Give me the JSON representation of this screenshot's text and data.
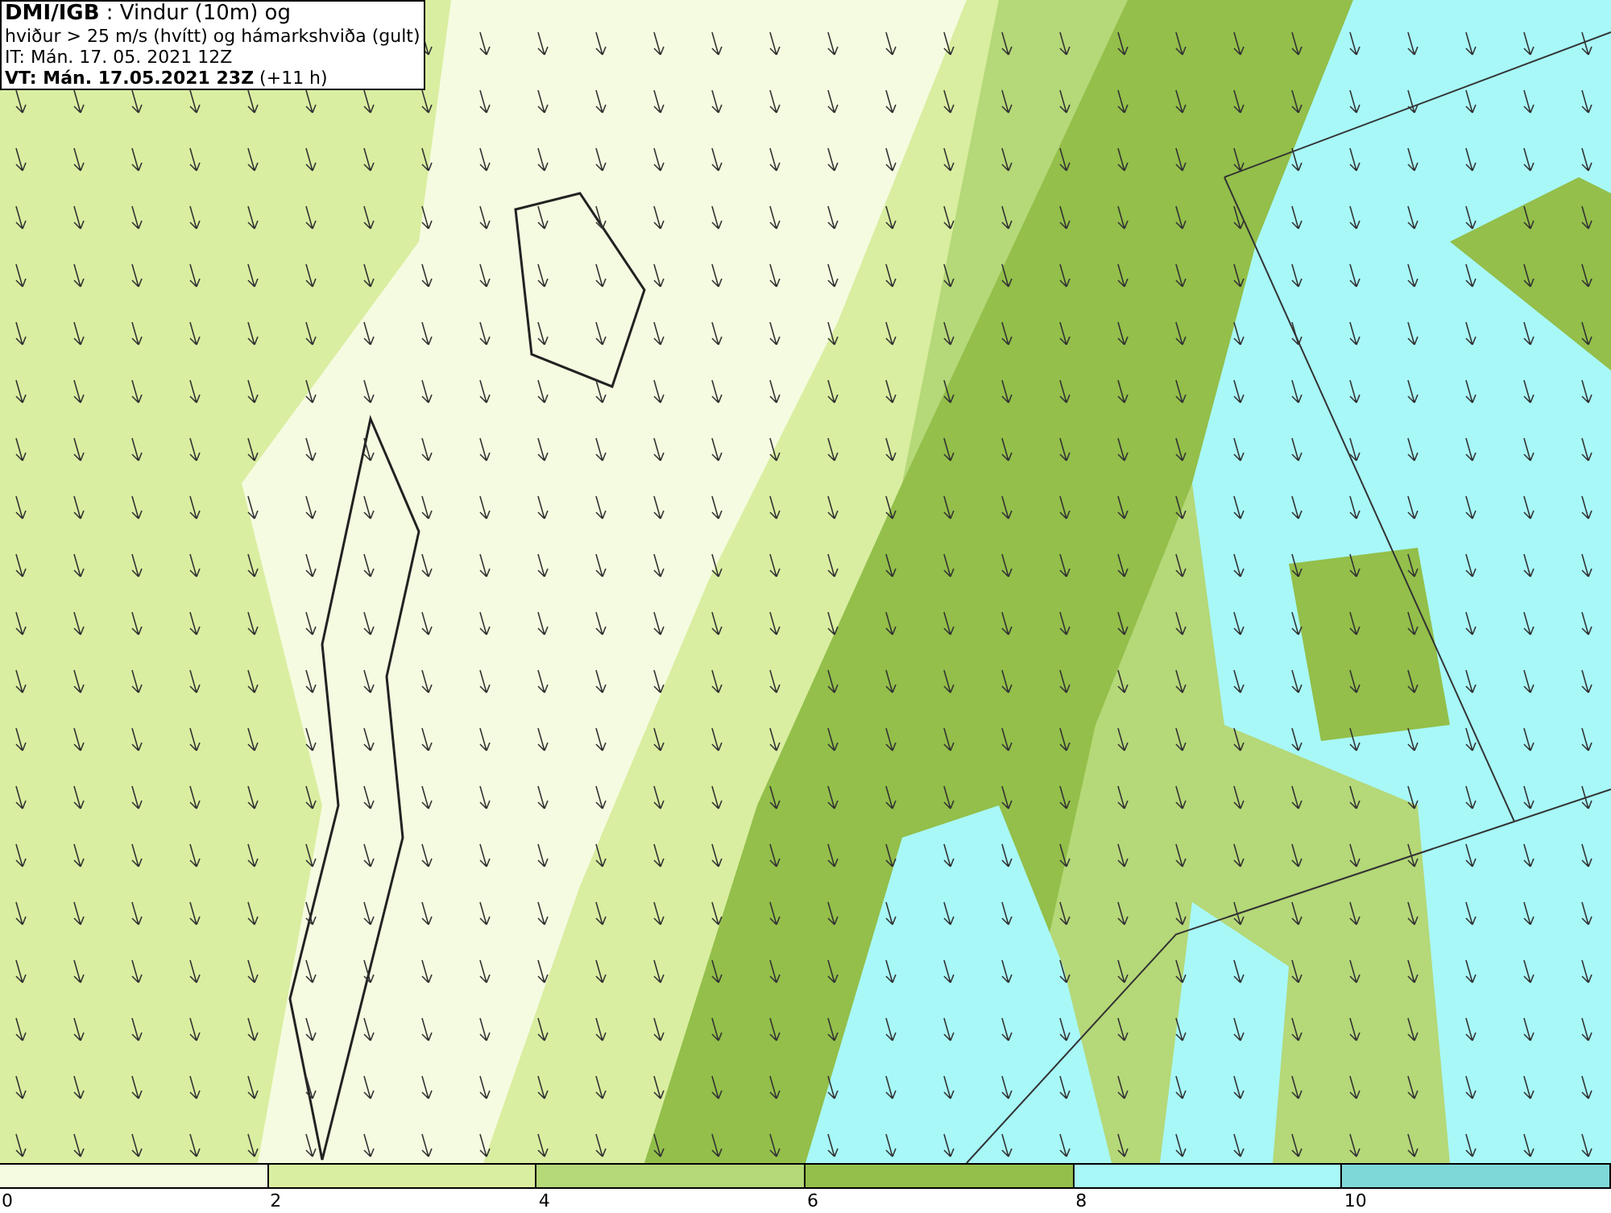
{
  "header": {
    "lines": [
      "**DMI/IGB** : Vindur (10m) og",
      "hviður > 25 m/s (hvítt) og hámarkshviða (gult)",
      "IT: Mán. 17. 05. 2021 12Z",
      "**VT: Mán. 17.05.2021 23Z** (+11 h)"
    ]
  },
  "legend": {
    "bins": [
      {
        "label": "0",
        "color": "#f5fbe0"
      },
      {
        "label": "2",
        "color": "#d9eea0"
      },
      {
        "label": "4",
        "color": "#b5d878"
      },
      {
        "label": "6",
        "color": "#93bf4a"
      },
      {
        "label": "8",
        "color": "#a8f8f8"
      },
      {
        "label": "10",
        "color": "#7fd8d8"
      }
    ]
  }
}
